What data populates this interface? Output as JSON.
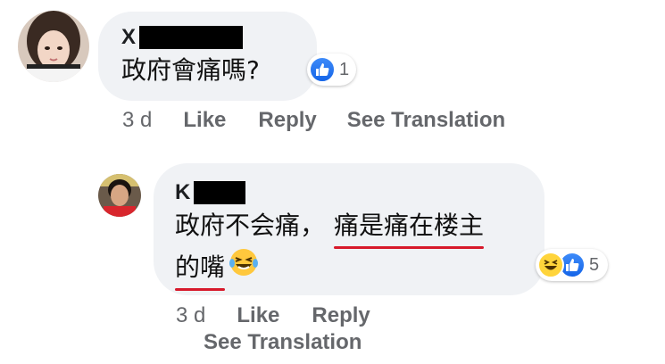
{
  "comments": [
    {
      "author_initial": "X",
      "text": "政府會痛嗎?",
      "reaction_count": "1",
      "reaction_icons": [
        "like-icon"
      ],
      "actions": {
        "time": "3 d",
        "like": "Like",
        "reply": "Reply",
        "translate": "See Translation"
      }
    },
    {
      "author_initial": "K",
      "text_plain": "政府不会痛，",
      "text_underlined_line1": "痛是痛在楼主",
      "text_underlined_line2": "的嘴",
      "emoji": "laughing-tears-emoji",
      "reaction_count": "5",
      "reaction_icons": [
        "haha-icon",
        "like-icon"
      ],
      "actions": {
        "time": "3 d",
        "like": "Like",
        "reply": "Reply",
        "translate": "See Translation"
      }
    }
  ],
  "colors": {
    "like_blue": "#1877f2",
    "underline_red": "#d7192b",
    "bubble_bg": "#f0f2f5",
    "action_gray": "#65676b"
  }
}
